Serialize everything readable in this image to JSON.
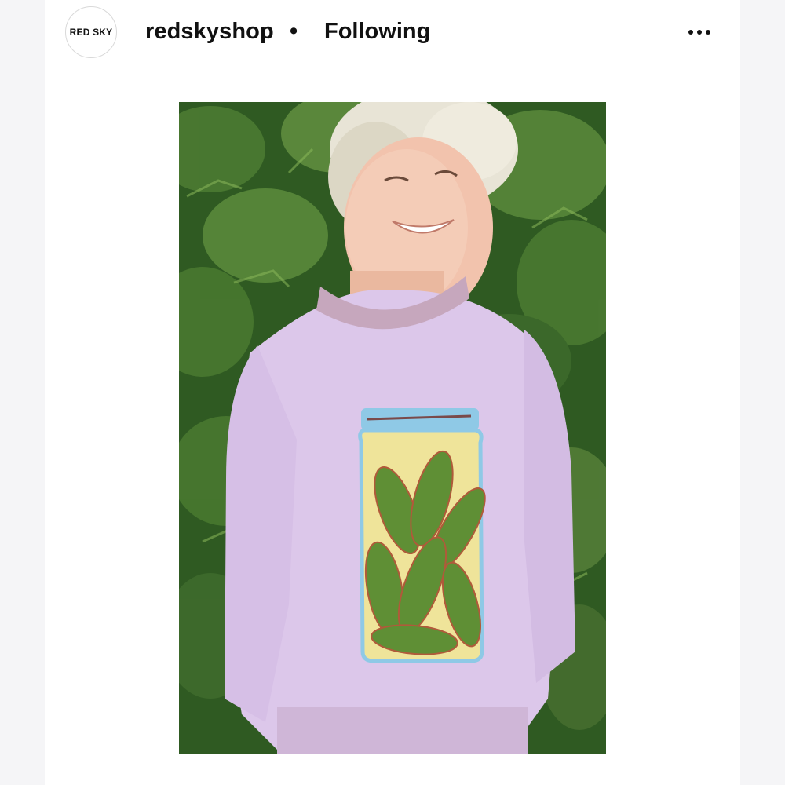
{
  "header": {
    "avatar_text": "RED SKY",
    "username": "redskyshop",
    "separator": "•",
    "follow_label": "Following",
    "more_icon": "more-horizontal-icon"
  },
  "post": {
    "image_subject": "photo",
    "colors": {
      "sweater": "#dcc7ea",
      "foliage": "#3e6b2c",
      "jar_lid": "#8fc9e6",
      "pickle": "#5f8f35",
      "brine": "#efe49a"
    }
  }
}
